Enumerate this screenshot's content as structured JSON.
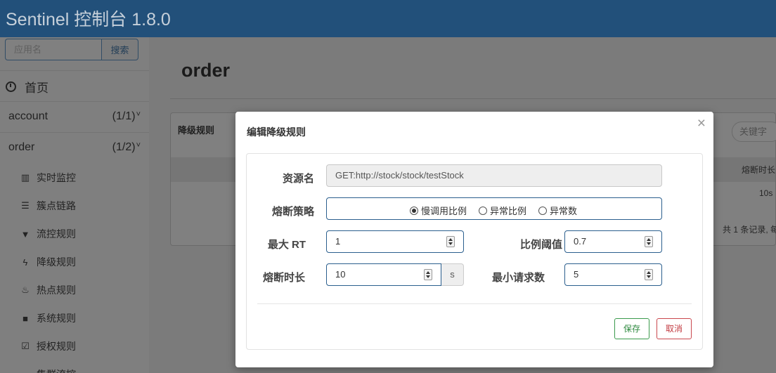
{
  "app": {
    "title": "Sentinel 控制台 1.8.0"
  },
  "sidebar": {
    "search_placeholder": "应用名",
    "search_button": "搜索",
    "home_label": "首页",
    "apps": [
      {
        "name": "account",
        "count": "(1/1)"
      },
      {
        "name": "order",
        "count": "(1/2)"
      }
    ],
    "submenu": [
      {
        "label": "实时监控",
        "icon": "bar-chart-icon"
      },
      {
        "label": "簇点链路",
        "icon": "list-icon"
      },
      {
        "label": "流控规则",
        "icon": "filter-icon"
      },
      {
        "label": "降级规则",
        "icon": "flash-icon"
      },
      {
        "label": "热点规则",
        "icon": "fire-icon"
      },
      {
        "label": "系统规则",
        "icon": "lock-icon"
      },
      {
        "label": "授权规则",
        "icon": "check-icon"
      },
      {
        "label": "集群流控",
        "icon": "cloud-icon"
      }
    ]
  },
  "main": {
    "page_title": "order",
    "panel_title": "降级规则",
    "keyword_placeholder": "关键字",
    "column_header": "熔断时长",
    "cell_value": "10s",
    "pager_text": "共 1 条记录, 每"
  },
  "modal": {
    "title": "编辑降级规则",
    "close_glyph": "×",
    "resource_label": "资源名",
    "resource_value": "GET:http://stock/stock/testStock",
    "strategy_label": "熔断策略",
    "strategy_options": [
      "慢调用比例",
      "异常比例",
      "异常数"
    ],
    "strategy_selected": "慢调用比例",
    "max_rt_label": "最大 RT",
    "max_rt_value": "1",
    "ratio_label": "比例阈值",
    "ratio_value": "0.7",
    "duration_label": "熔断时长",
    "duration_value": "10",
    "duration_unit": "s",
    "min_requests_label": "最小请求数",
    "min_requests_value": "5",
    "save_button": "保存",
    "cancel_button": "取消"
  },
  "colors": {
    "header": "#22507a",
    "input_border": "#2b5f8e",
    "save": "#3a9a4c",
    "cancel": "#c9474d"
  }
}
